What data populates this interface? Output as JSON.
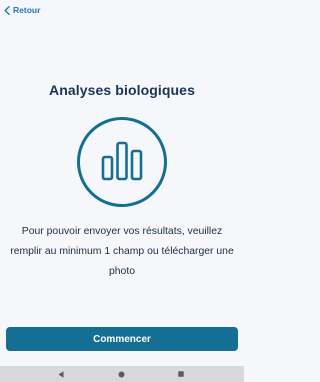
{
  "header": {
    "back_label": "Retour",
    "back_icon": "chevron-left-icon"
  },
  "main": {
    "title": "Analyses biologiques",
    "icon": "bar-chart-icon",
    "description": "Pour pouvoir envoyer vos résultats, veuillez remplir au minimum 1 champ ou télécharger une photo"
  },
  "actions": {
    "start_label": "Commencer"
  },
  "system_nav": {
    "back_icon": "nav-back-triangle-icon",
    "home_icon": "nav-home-circle-icon",
    "recent_icon": "nav-recent-square-icon"
  },
  "colors": {
    "background": "#f6f7fb",
    "accent": "#156f94",
    "link": "#1e7aa6",
    "title": "#173556",
    "text": "#1b2d44",
    "navbar": "#d9d9db"
  }
}
